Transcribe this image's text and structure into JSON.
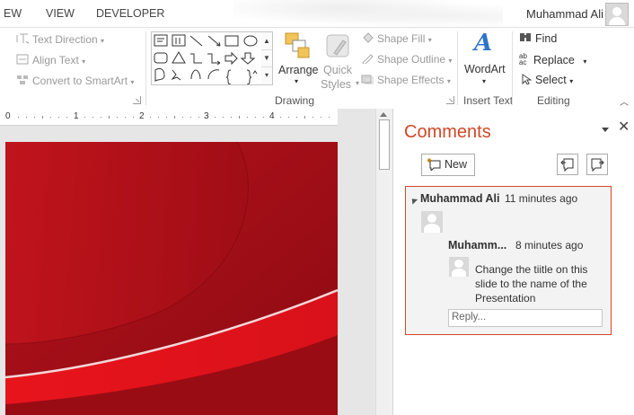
{
  "tabs": [
    "EW",
    "VIEW",
    "DEVELOPER"
  ],
  "user": {
    "name": "Muhammad Ali"
  },
  "ribbon": {
    "paragraph_items": {
      "text_direction": "Text Direction",
      "align_text": "Align Text",
      "convert_smartart": "Convert to SmartArt"
    },
    "drawing": {
      "label": "Drawing",
      "arrange": "Arrange",
      "quick_styles_1": "Quick",
      "quick_styles_2": "Styles",
      "shape_fill": "Shape Fill",
      "shape_outline": "Shape Outline",
      "shape_effects": "Shape Effects"
    },
    "insert_text": {
      "label": "Insert Text",
      "wordart": "WordArt"
    },
    "editing": {
      "label": "Editing",
      "find": "Find",
      "replace": "Replace",
      "select": "Select"
    }
  },
  "ruler": {
    "numbers": [
      "0",
      "1",
      "2",
      "3",
      "4"
    ]
  },
  "comments": {
    "title": "Comments",
    "new_label": "New",
    "thread": {
      "author": "Muhammad Ali",
      "time": "11 minutes ago",
      "reply": {
        "author": "Muhamm...",
        "time": "8 minutes ago",
        "text": "Change the tiitle on this slide to the name of the Presentation"
      },
      "reply_placeholder": "Reply..."
    }
  },
  "colors": {
    "accent": "#d24726",
    "slide_red": "#b5121b"
  },
  "icons": [
    "text-direction-icon",
    "align-text-icon",
    "convert-smartart-icon",
    "arrange-icon",
    "quick-styles-icon",
    "shape-fill-icon",
    "shape-outline-icon",
    "shape-effects-icon",
    "wordart-icon",
    "find-icon",
    "replace-icon",
    "select-icon",
    "new-comment-icon",
    "previous-comment-icon",
    "next-comment-icon",
    "close-icon"
  ]
}
